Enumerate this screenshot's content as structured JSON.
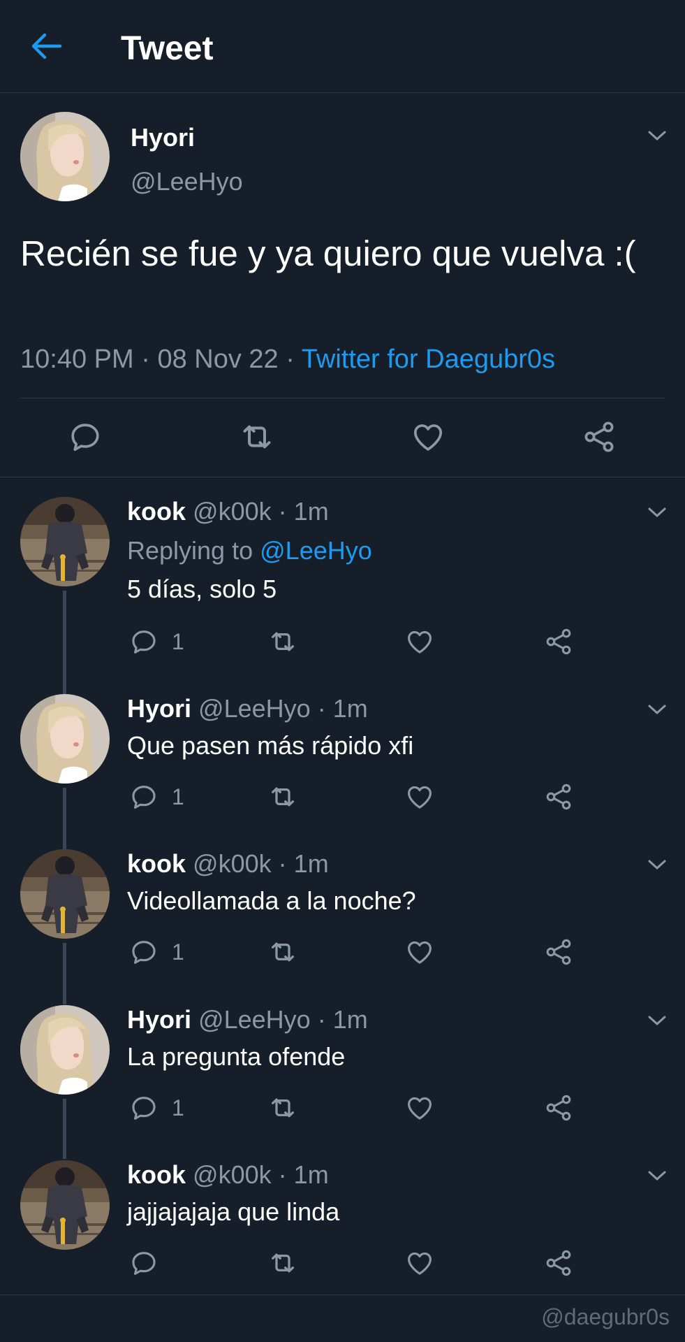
{
  "header": {
    "title": "Tweet"
  },
  "main_tweet": {
    "name": "Hyori",
    "handle": "@LeeHyo",
    "text": "Recién se fue y ya quiero que vuelva :(",
    "time": "10:40 PM",
    "date": "08 Nov 22",
    "source": "Twitter for Daegubr0s",
    "separator": "·"
  },
  "replies": [
    {
      "name": "kook",
      "handle": "@k00k",
      "time": "1m",
      "replying_label": "Replying to",
      "replying_to": "@LeeHyo",
      "text": "5 días, solo 5",
      "reply_count": "1"
    },
    {
      "name": "Hyori",
      "handle": "@LeeHyo",
      "time": "1m",
      "text": "Que pasen más rápido xfi",
      "reply_count": "1"
    },
    {
      "name": "kook",
      "handle": "@k00k",
      "time": "1m",
      "text": "Videollamada a la noche?",
      "reply_count": "1"
    },
    {
      "name": "Hyori",
      "handle": "@LeeHyo",
      "time": "1m",
      "text": "La pregunta ofende",
      "reply_count": "1"
    },
    {
      "name": "kook",
      "handle": "@k00k",
      "time": "1m",
      "text": "jajjajajaja que linda",
      "reply_count": ""
    }
  ],
  "watermark": "@daegubr0s",
  "colors": {
    "background": "#151e29",
    "accent": "#1d9bf0",
    "secondary_text": "#8b98a5",
    "divider": "#2c3744"
  },
  "icons": {
    "back": "arrow-left-icon",
    "chevron": "chevron-down-icon",
    "reply": "reply-bubble-icon",
    "retweet": "retweet-icon",
    "like": "heart-icon",
    "share": "share-icon"
  }
}
